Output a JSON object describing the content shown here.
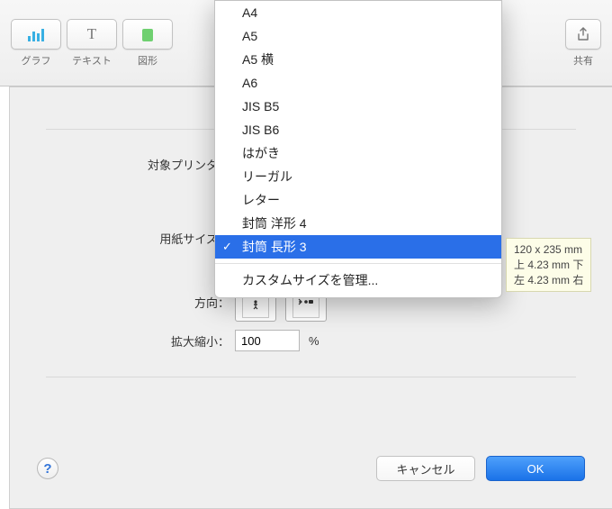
{
  "toolbar": {
    "items": [
      {
        "label": "グラフ",
        "icon": "chart-icon"
      },
      {
        "label": "テキスト",
        "icon": "text-icon"
      },
      {
        "label": "図形",
        "icon": "shape-icon"
      },
      {
        "label": "共有",
        "icon": "share-icon"
      }
    ]
  },
  "dialog": {
    "printer_label": "対象プリンタ：",
    "paper_size_label": "用紙サイズ：",
    "orientation_label": "方向：",
    "scale_label": "拡大縮小：",
    "scale_value": "100",
    "scale_unit": "%",
    "cancel": "キャンセル",
    "ok": "OK",
    "help": "?"
  },
  "paper_sizes": [
    "A4",
    "A5",
    "A5 横",
    "A6",
    "JIS B5",
    "JIS B6",
    "はがき",
    "リーガル",
    "レター",
    "封筒 洋形 4",
    "封筒 長形 3"
  ],
  "paper_size_selected_index": 10,
  "paper_size_manage": "カスタムサイズを管理...",
  "tooltip": {
    "line1": "120 x 235 mm",
    "line2": "上 4.23 mm 下",
    "line3": "左 4.23 mm 右"
  }
}
